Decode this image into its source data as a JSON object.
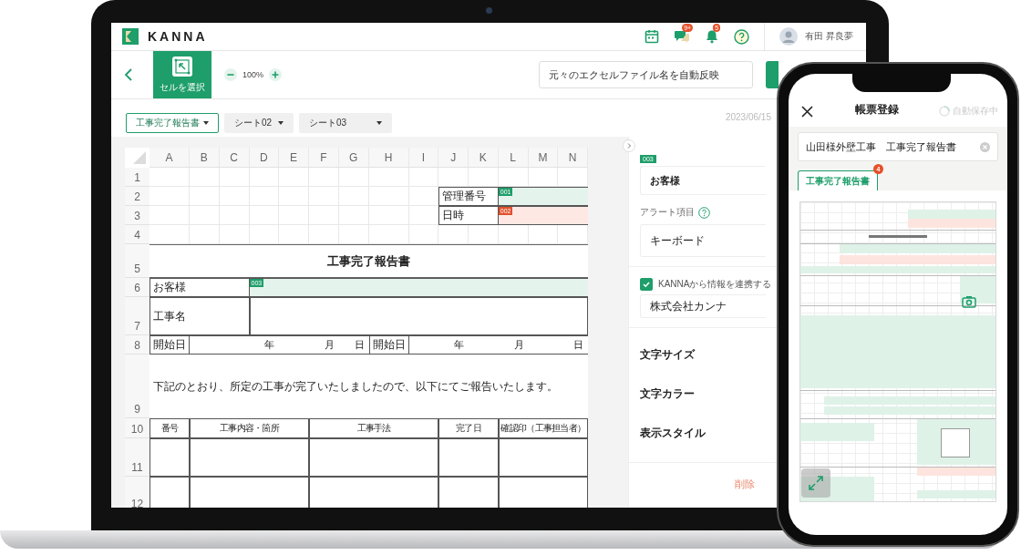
{
  "app": {
    "logo": "KANNA",
    "notifications": [
      {
        "kind": "calendar"
      },
      {
        "kind": "chat",
        "badge": "9+"
      },
      {
        "kind": "bell",
        "badge": "5"
      },
      {
        "kind": "help"
      }
    ],
    "user": {
      "name": "有田 昇良夢"
    }
  },
  "toolbar": {
    "tool": {
      "label": "セルを選択",
      "selected": true
    },
    "zoom": "100%",
    "file_name": "元々のエクセルファイル名を自動反映"
  },
  "sheet_tabs": [
    {
      "label": "工事完了報告書",
      "selected": true
    },
    {
      "label": "シート02",
      "selected": false
    },
    {
      "label": "シート03",
      "selected": false
    }
  ],
  "date": "2023/06/15",
  "sheet": {
    "columns": [
      "A",
      "B",
      "C",
      "D",
      "E",
      "F",
      "G",
      "H",
      "I",
      "J",
      "K",
      "L",
      "M",
      "N"
    ],
    "rows": [
      "1",
      "2",
      "3",
      "4",
      "5",
      "6",
      "7",
      "8",
      "9",
      "10",
      "11",
      "12"
    ],
    "cells": [
      {
        "kind": "label",
        "text": "管理番号"
      },
      {
        "kind": "field",
        "color": "#e4f4ec",
        "tag": {
          "text": "001",
          "color": "#1e9e6a"
        }
      },
      {
        "kind": "label",
        "text": "日時"
      },
      {
        "kind": "field",
        "color": "#fde8e4",
        "tag": {
          "text": "002",
          "color": "#e0502c"
        }
      },
      {
        "kind": "title",
        "text": "工事完了報告書"
      },
      {
        "kind": "label",
        "text": "お客様"
      },
      {
        "kind": "field",
        "color": "#e4f4ec",
        "tag": {
          "text": "003",
          "color": "#1e9e6a"
        }
      },
      {
        "kind": "label",
        "text": "工事名"
      },
      {
        "kind": "blank"
      },
      {
        "kind": "label",
        "text": "開始日"
      },
      {
        "kind": "date_part",
        "text": "年"
      },
      {
        "kind": "date_part",
        "text": "月"
      },
      {
        "kind": "date_part",
        "text": "日"
      },
      {
        "kind": "label",
        "text": "開始日"
      },
      {
        "kind": "date_part",
        "text": "年"
      },
      {
        "kind": "date_part",
        "text": "月"
      },
      {
        "kind": "date_part",
        "text": "日"
      },
      {
        "kind": "text",
        "text": "下記のとおり、所定の工事が完了いたしましたので、以下にてご報告いたします。"
      },
      {
        "kind": "header",
        "text": "番号"
      },
      {
        "kind": "header",
        "text": "工事内容・箇所"
      },
      {
        "kind": "header",
        "text": "工事手法"
      },
      {
        "kind": "header",
        "text": "完了日"
      },
      {
        "kind": "header",
        "text": "確認印（工事担当者）"
      },
      {
        "kind": "blank"
      },
      {
        "kind": "blank"
      },
      {
        "kind": "blank"
      },
      {
        "kind": "blank"
      },
      {
        "kind": "blank"
      },
      {
        "kind": "blank"
      },
      {
        "kind": "blank"
      },
      {
        "kind": "blank"
      },
      {
        "kind": "blank"
      },
      {
        "kind": "blank"
      }
    ]
  },
  "properties": {
    "tag": "003",
    "field_name": "お客様",
    "alert_label": "アラート項目",
    "input_type": "キーボード",
    "link": {
      "label": "KANNAから情報を連携する",
      "checked": true
    },
    "linked_value": "株式会社カンナ",
    "settings": [
      "文字サイズ",
      "文字カラー",
      "表示スタイル"
    ],
    "delete": "削除"
  },
  "phone": {
    "title": "帳票登録",
    "autosave": "自動保存中",
    "document_name": "山田様外壁工事　工事完了報告書",
    "tabs": [
      {
        "label": "工事完了報告書",
        "selected": true,
        "badge": "4"
      }
    ]
  }
}
